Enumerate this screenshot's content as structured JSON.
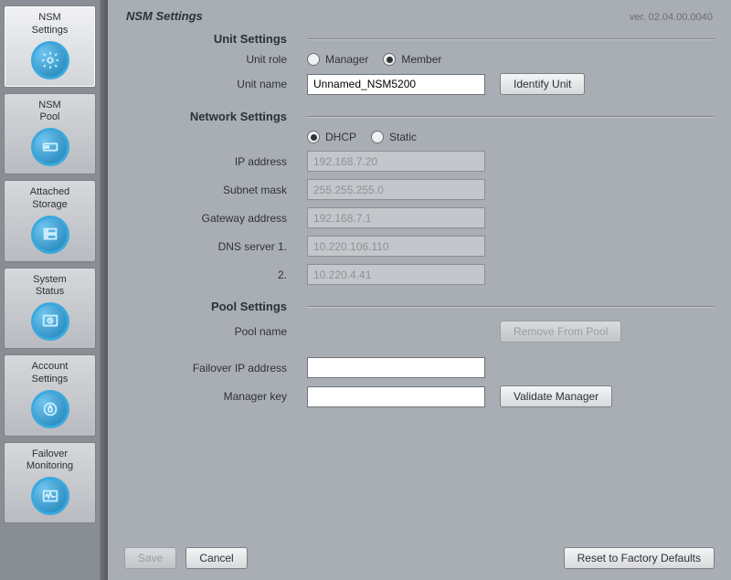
{
  "sidebar": {
    "items": [
      {
        "label_line1": "NSM",
        "label_line2": "Settings",
        "icon": "settings-icon",
        "selected": true
      },
      {
        "label_line1": "NSM",
        "label_line2": "Pool",
        "icon": "pool-icon"
      },
      {
        "label_line1": "Attached",
        "label_line2": "Storage",
        "icon": "storage-icon"
      },
      {
        "label_line1": "System",
        "label_line2": "Status",
        "icon": "status-icon"
      },
      {
        "label_line1": "Account",
        "label_line2": "Settings",
        "icon": "account-icon"
      },
      {
        "label_line1": "Failover",
        "label_line2": "Monitoring",
        "icon": "monitoring-icon"
      }
    ]
  },
  "header": {
    "title": "NSM Settings",
    "version": "ver. 02.04.00.0040"
  },
  "sections": {
    "unit": {
      "title": "Unit Settings",
      "role_label": "Unit role",
      "role_options": {
        "manager": "Manager",
        "member": "Member"
      },
      "role_selected": "member",
      "name_label": "Unit name",
      "name_value": "Unnamed_NSM5200",
      "identify_button": "Identify Unit"
    },
    "network": {
      "title": "Network Settings",
      "mode_options": {
        "dhcp": "DHCP",
        "static": "Static"
      },
      "mode_selected": "dhcp",
      "ip_label": "IP address",
      "ip_value": "192.168.7.20",
      "subnet_label": "Subnet mask",
      "subnet_value": "255.255.255.0",
      "gateway_label": "Gateway address",
      "gateway_value": "192.168.7.1",
      "dns1_label": "DNS server 1.",
      "dns1_value": "10.220.106.110",
      "dns2_label": "2.",
      "dns2_value": "10.220.4.41"
    },
    "pool": {
      "title": "Pool Settings",
      "pool_name_label": "Pool name",
      "pool_name_value": "",
      "remove_button": "Remove From Pool",
      "failover_label": "Failover IP address",
      "failover_value": "",
      "manager_key_label": "Manager key",
      "manager_key_value": "",
      "validate_button": "Validate Manager"
    }
  },
  "footer": {
    "save": "Save",
    "cancel": "Cancel",
    "reset": "Reset to Factory Defaults"
  }
}
